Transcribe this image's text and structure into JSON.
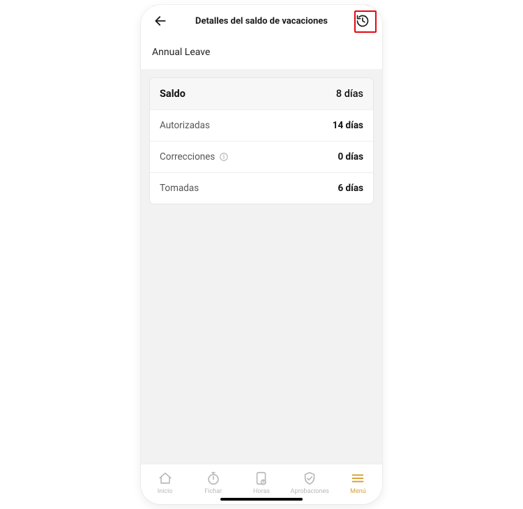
{
  "header": {
    "title": "Detalles del saldo de vacaciones",
    "back_icon": "arrow-left-icon",
    "history_icon": "history-icon"
  },
  "leave_type": "Annual Leave",
  "balance_card": {
    "summary_label": "Saldo",
    "summary_value": "8 días",
    "rows": [
      {
        "label": "Autorizadas",
        "value": "14 días",
        "info": false
      },
      {
        "label": "Correcciones",
        "value": "0 días",
        "info": true
      },
      {
        "label": "Tomadas",
        "value": "6 días",
        "info": false
      }
    ]
  },
  "tabbar": {
    "items": [
      {
        "label": "Inicio",
        "icon": "home-icon",
        "active": false
      },
      {
        "label": "Fichar",
        "icon": "stopwatch-icon",
        "active": false
      },
      {
        "label": "Horas",
        "icon": "hours-icon",
        "active": false
      },
      {
        "label": "Aprobaciones",
        "icon": "shield-icon",
        "active": false
      },
      {
        "label": "Menú",
        "icon": "menu-icon",
        "active": true
      }
    ]
  },
  "colors": {
    "accent": "#d6a23a",
    "highlight": "#e30613"
  }
}
